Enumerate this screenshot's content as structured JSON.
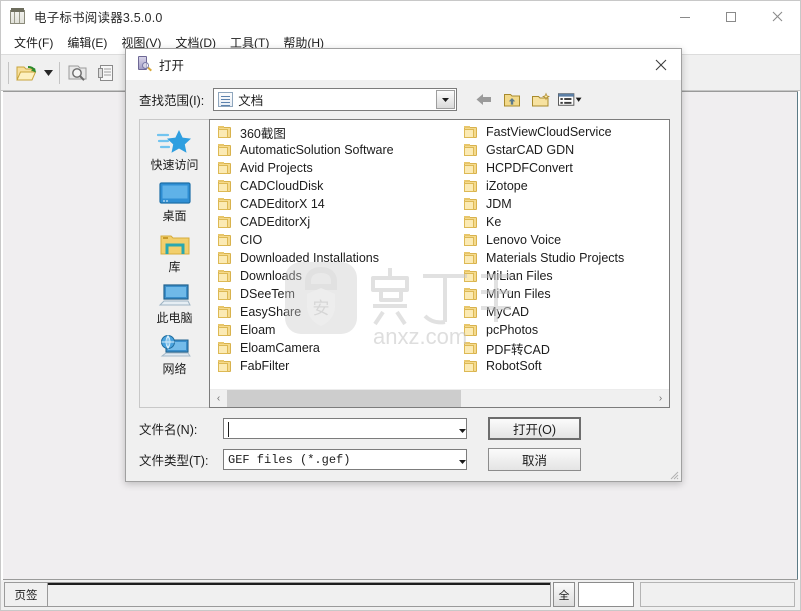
{
  "app": {
    "title": "电子标书阅读器3.5.0.0",
    "icon": "book-reader-icon",
    "window_controls": [
      {
        "name": "minimize-button",
        "glyph": "minimize-icon"
      },
      {
        "name": "maximize-button",
        "glyph": "maximize-icon"
      },
      {
        "name": "close-button",
        "glyph": "close-icon"
      }
    ],
    "menu": [
      {
        "label": "文件(F)",
        "name": "menu-file"
      },
      {
        "label": "编辑(E)",
        "name": "menu-edit"
      },
      {
        "label": "视图(V)",
        "name": "menu-view"
      },
      {
        "label": "文档(D)",
        "name": "menu-document"
      },
      {
        "label": "工具(T)",
        "name": "menu-tools"
      },
      {
        "label": "帮助(H)",
        "name": "menu-help"
      }
    ],
    "toolbar": [
      {
        "name": "open-file-button",
        "icon": "open-folder-icon"
      },
      {
        "name": "open-dropdown-button",
        "icon": "chevron-down-icon"
      },
      {
        "name": "print-preview-button",
        "icon": "preview-magnifier-icon"
      },
      {
        "name": "page-setup-button",
        "icon": "page-icon"
      }
    ],
    "statusbar": {
      "tab_label": "页签",
      "all_button": "全",
      "page_input_value": "",
      "info_value": ""
    }
  },
  "dialog": {
    "title": "打开",
    "icon": "open-dialog-icon",
    "close_label": "×",
    "lookin": {
      "label": "查找范围(I):",
      "value": "文档",
      "icon": "documents-folder-icon"
    },
    "nav_buttons": [
      {
        "name": "back-button",
        "icon": "back-arrow-icon"
      },
      {
        "name": "up-one-level-button",
        "icon": "up-folder-icon"
      },
      {
        "name": "new-folder-button",
        "icon": "new-folder-icon"
      },
      {
        "name": "views-button",
        "icon": "views-list-icon"
      }
    ],
    "places": [
      {
        "label": "快速访问",
        "name": "place-quick-access",
        "icon": "star-icon"
      },
      {
        "label": "桌面",
        "name": "place-desktop",
        "icon": "desktop-icon"
      },
      {
        "label": "库",
        "name": "place-libraries",
        "icon": "library-folder-icon"
      },
      {
        "label": "此电脑",
        "name": "place-this-pc",
        "icon": "computer-icon"
      },
      {
        "label": "网络",
        "name": "place-network",
        "icon": "network-globe-icon"
      }
    ],
    "file_columns": [
      [
        "360截图",
        "AutomaticSolution Software",
        "Avid Projects",
        "CADCloudDisk",
        "CADEditorX 14",
        "CADEditorXj",
        "CIO",
        "Downloaded Installations",
        "Downloads",
        "DSeeTem",
        "EasyShare",
        "Eloam",
        "EloamCamera",
        "FabFilter"
      ],
      [
        "FastViewCloudService",
        "GstarCAD GDN",
        "HCPDFConvert",
        "iZotope",
        "JDM",
        "Ke",
        "Lenovo Voice",
        "Materials Studio Projects",
        "MiLian Files",
        "MiYun Files",
        "MyCAD",
        "pcPhotos",
        "PDF转CAD",
        "RobotSoft"
      ]
    ],
    "scrollbar": {
      "left_arrow": "‹",
      "right_arrow": "›",
      "thumb_percent": 55
    },
    "filename": {
      "label": "文件名(N):",
      "value": "",
      "placeholder": ""
    },
    "filetype": {
      "label": "文件类型(T):",
      "value": "GEF files (*.gef)"
    },
    "buttons": [
      {
        "label": "打开(O)",
        "name": "open-button",
        "default": true
      },
      {
        "label": "取消",
        "name": "cancel-button",
        "default": false
      }
    ]
  },
  "watermark": {
    "text": "anxz.com",
    "mark": "安"
  },
  "colors": {
    "dialog_bg": "#f0f0f0",
    "list_bg": "#ffffff",
    "folder_yellow": "#f5da8d",
    "accent_blue": "#2f88d8"
  }
}
